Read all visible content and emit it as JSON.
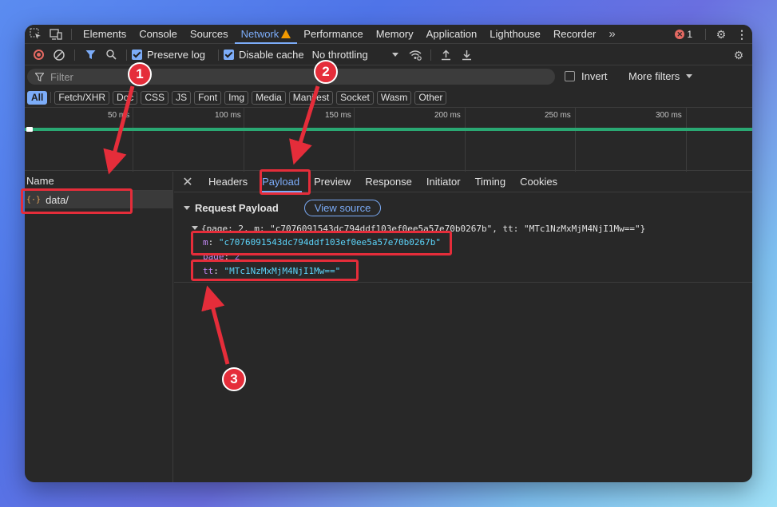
{
  "devtools": {
    "tabs": [
      "Elements",
      "Console",
      "Sources",
      "Network",
      "Performance",
      "Memory",
      "Application",
      "Lighthouse",
      "Recorder"
    ],
    "active_tab": "Network",
    "more_tabs": "»",
    "error_count": "1",
    "icons": {
      "inspect": "inspect-element-icon",
      "device": "device-toolbar-icon",
      "settings": "gear-icon",
      "menu": "kebab-menu-icon",
      "warning": "warning-icon",
      "error": "error-icon"
    }
  },
  "toolbar": {
    "preserve_log": "Preserve log",
    "preserve_log_checked": true,
    "disable_cache": "Disable cache",
    "disable_cache_checked": true,
    "throttling": "No throttling"
  },
  "filter": {
    "placeholder": "Filter",
    "invert": "Invert",
    "more_filters": "More filters"
  },
  "type_filters": [
    "All",
    "Fetch/XHR",
    "Doc",
    "CSS",
    "JS",
    "Font",
    "Img",
    "Media",
    "Manifest",
    "Socket",
    "Wasm",
    "Other"
  ],
  "active_type_filter": "All",
  "timeline": {
    "ticks": [
      "50 ms",
      "100 ms",
      "150 ms",
      "200 ms",
      "250 ms",
      "300 ms"
    ]
  },
  "request_list": {
    "header": "Name",
    "rows": [
      {
        "name": "data/",
        "icon": "{·}"
      }
    ]
  },
  "detail": {
    "tabs": [
      "Headers",
      "Payload",
      "Preview",
      "Response",
      "Initiator",
      "Timing",
      "Cookies"
    ],
    "active_tab": "Payload",
    "section_title": "Request Payload",
    "view_source": "View source",
    "summary": "{page: 2, m: \"c7076091543dc794ddf103ef0ee5a57e70b0267b\", tt: \"MTc1NzMxMjM4NjI1Mw==\"}",
    "props": [
      {
        "key": "m",
        "value": "\"c7076091543dc794ddf103ef0ee5a57e70b0267b\"",
        "kind": "string"
      },
      {
        "key": "page",
        "value": "2",
        "kind": "number"
      },
      {
        "key": "tt",
        "value": "\"MTc1NzMxMjM4NjI1Mw==\"",
        "kind": "string"
      }
    ]
  },
  "annotations": {
    "step1": "1",
    "step2": "2",
    "step3": "3",
    "color": "#e52d3a"
  }
}
